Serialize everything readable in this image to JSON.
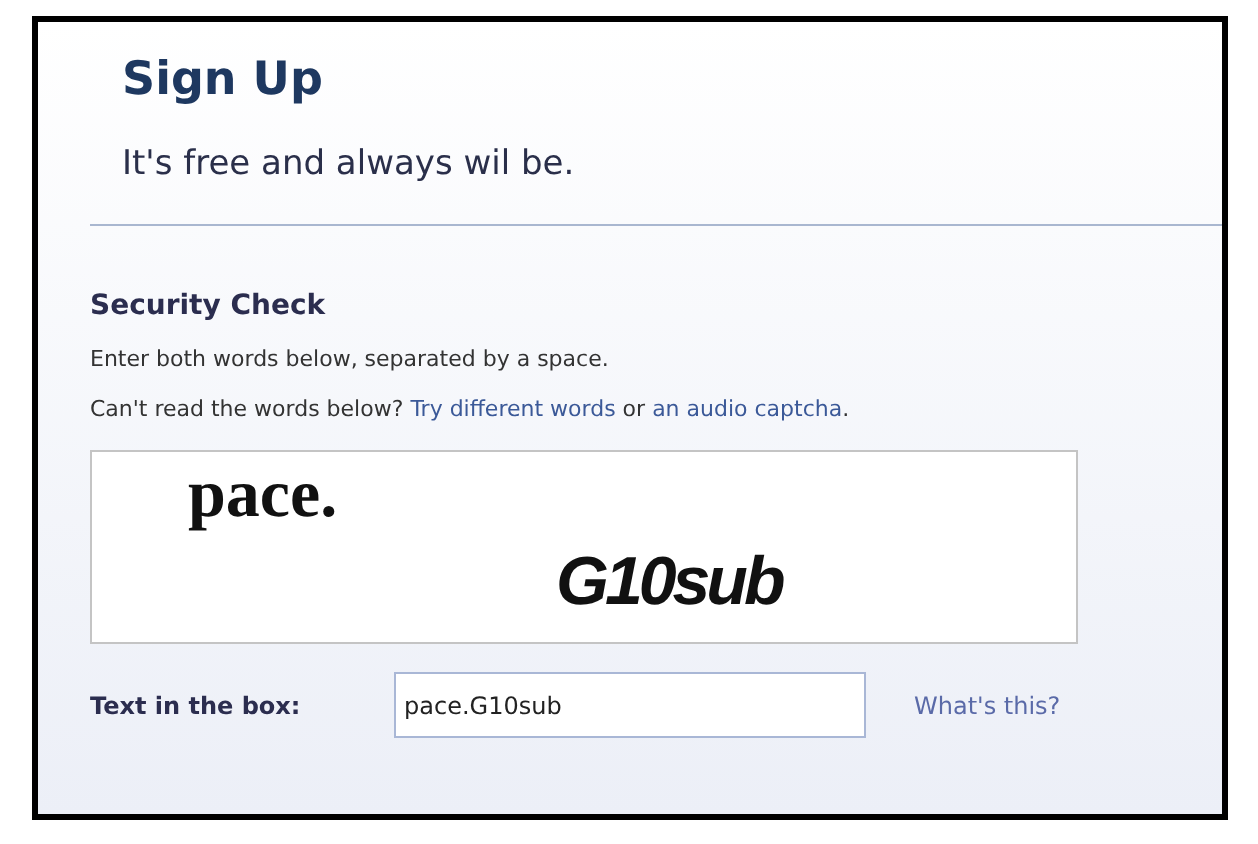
{
  "header": {
    "title": "Sign Up",
    "subtitle": "It's free and always wil be."
  },
  "security_check": {
    "heading": "Security Check",
    "instructions": "Enter both words below, separated by a space.",
    "help_line": [
      {
        "kind": "text",
        "text": "Can't read the words below? "
      },
      {
        "kind": "link",
        "text": "Try different words"
      },
      {
        "kind": "text",
        "text": " or "
      },
      {
        "kind": "link",
        "text": "an audio captcha"
      },
      {
        "kind": "text",
        "text": "."
      }
    ],
    "captcha": {
      "words": [
        "pace.",
        "G10sub"
      ]
    },
    "field": {
      "label": "Text in the box:",
      "value": "pace.G10sub"
    },
    "help_link": "What's this?"
  }
}
